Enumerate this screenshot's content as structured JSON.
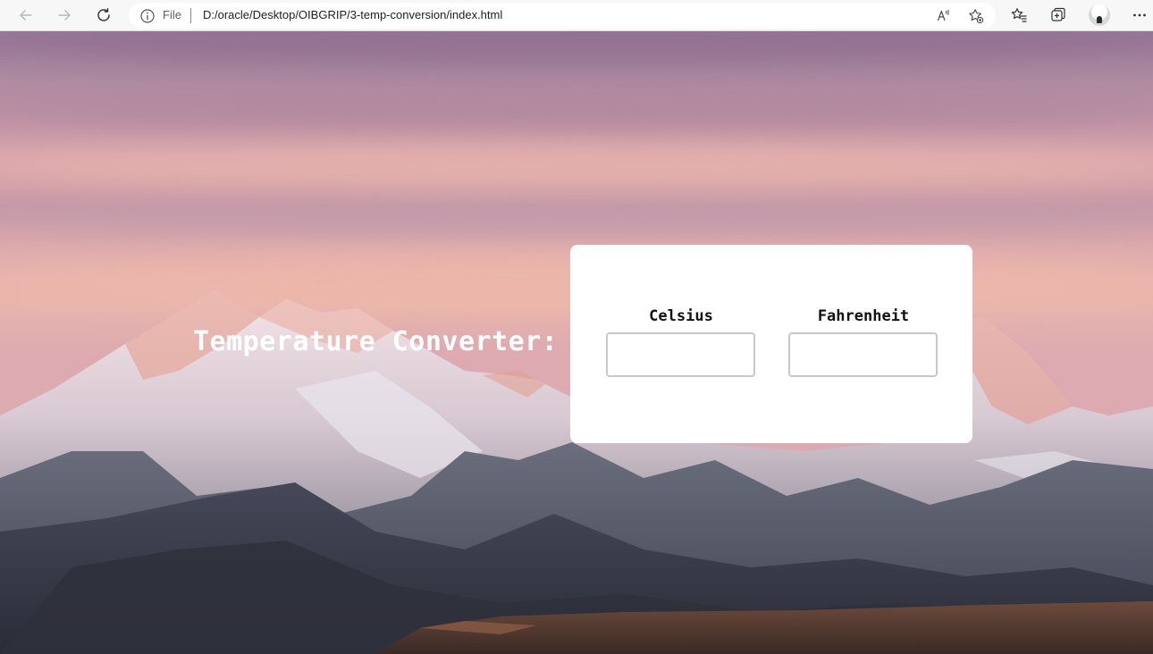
{
  "browser": {
    "address": {
      "scheme_label": "File",
      "url": "D:/oracle/Desktop/OIBGRIP/3-temp-conversion/index.html"
    },
    "icons": {
      "back": "back-arrow-icon",
      "forward": "forward-arrow-icon",
      "refresh": "refresh-icon",
      "info": "info-icon",
      "read_aloud": "read-aloud-icon",
      "add_favorite": "add-favorite-icon",
      "favorites": "favorites-icon",
      "collections": "collections-icon",
      "profile": "profile-avatar",
      "more": "more-icon"
    }
  },
  "page": {
    "heading": "Temperature Converter:",
    "converter": {
      "celsius": {
        "label": "Celsius",
        "value": ""
      },
      "fahrenheit": {
        "label": "Fahrenheit",
        "value": ""
      }
    }
  },
  "colors": {
    "card_background": "#ffffff",
    "heading_color": "#ffffff",
    "input_border": "#c8c8c8"
  }
}
